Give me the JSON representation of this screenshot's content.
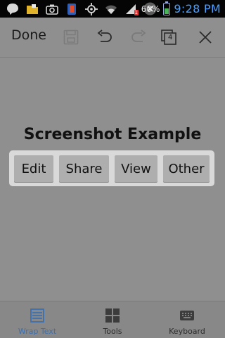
{
  "status_bar": {
    "battery_percent": "60%",
    "battery_level": 0.6,
    "time": "9:28 PM",
    "sim_badge": "1"
  },
  "toolbar": {
    "done_label": "Done",
    "count_badge": "4"
  },
  "main": {
    "title": "Screenshot Example",
    "buttons": [
      {
        "label": "Edit"
      },
      {
        "label": "Share"
      },
      {
        "label": "View"
      },
      {
        "label": "Other"
      }
    ]
  },
  "bottom_nav": [
    {
      "label": "Wrap Text",
      "icon": "wrap-text-icon",
      "active": true
    },
    {
      "label": "Tools",
      "icon": "tools-grid-icon",
      "active": false
    },
    {
      "label": "Keyboard",
      "icon": "keyboard-icon",
      "active": false
    }
  ],
  "colors": {
    "accent": "#3a6fb0",
    "time": "#4aa0ff",
    "background": "#8f8f8f"
  }
}
